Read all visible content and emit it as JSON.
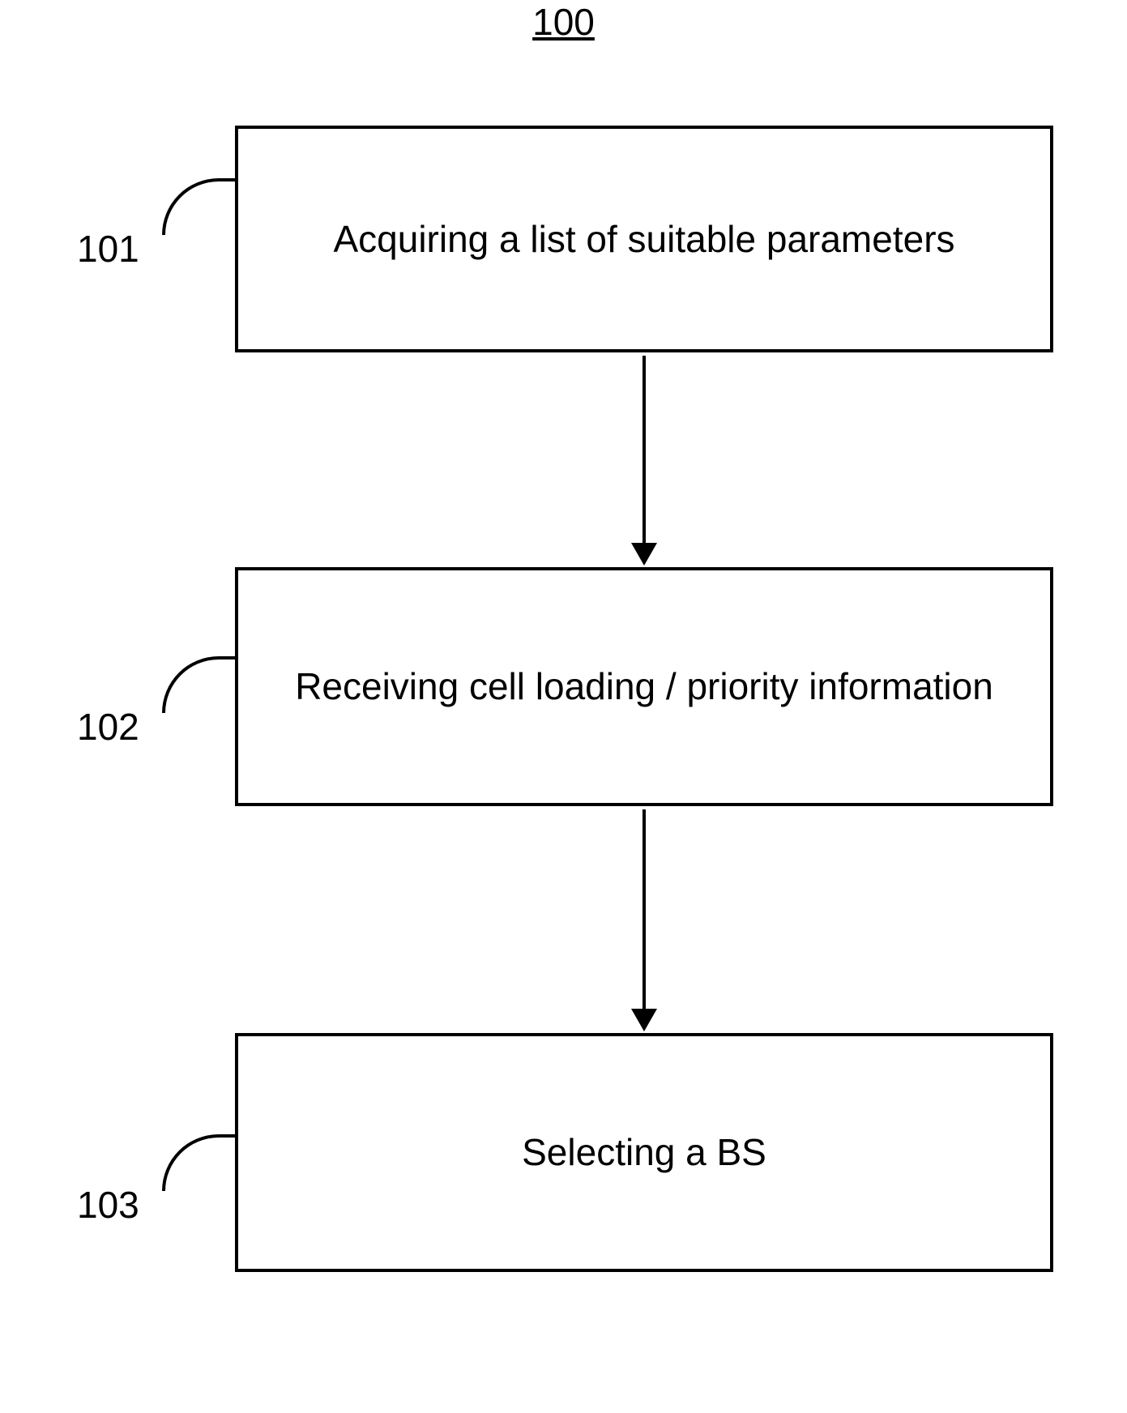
{
  "figure_ref": "100",
  "steps": [
    {
      "ref": "101",
      "text": "Acquiring a list of suitable parameters"
    },
    {
      "ref": "102",
      "text": "Receiving cell loading / priority information"
    },
    {
      "ref": "103",
      "text": "Selecting a BS"
    }
  ]
}
